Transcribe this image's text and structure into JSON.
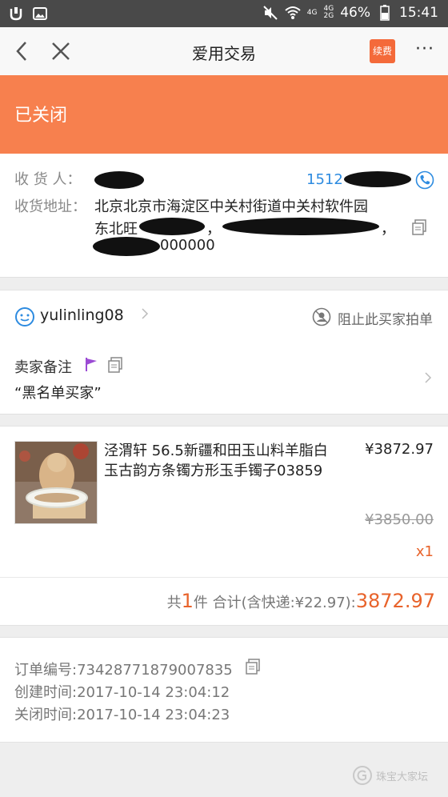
{
  "status_bar": {
    "battery": "46%",
    "time": "15:41",
    "net_top": "4G",
    "net_mid": "4G",
    "net_bottom": "2G"
  },
  "nav": {
    "title": "爱用交易",
    "renew_label": "续费",
    "more_label": "···"
  },
  "banner": {
    "status": "已关闭"
  },
  "address": {
    "recipient_label": "收 货 人：",
    "phone": "1512",
    "address_label": "收货地址：",
    "line1": "北京北京市海淀区中关村街道中关村软件园",
    "line2_prefix": "东北旺",
    "line2_comma1": "，",
    "line2_comma2": "，",
    "line3_suffix": "000000"
  },
  "buyer": {
    "name": "yulinling08",
    "block_label": "阻止此买家拍单"
  },
  "remark": {
    "label": "卖家备注",
    "text": "“黑名单买家”"
  },
  "product": {
    "title": "泾渭轩 56.5新疆和田玉山料羊脂白玉古韵方条镯方形玉手镯子03859",
    "price": "¥3872.97",
    "original_price": "¥3850.00",
    "quantity": "x1"
  },
  "totals": {
    "prefix": "共",
    "count": "1",
    "suffix": "件 合计(含快递:¥22.97):",
    "amount": "3872.97"
  },
  "order": {
    "number_line": "订单编号:73428771879007835",
    "created_line": "创建时间:2017-10-14 23:04:12",
    "closed_line": "关闭时间:2017-10-14 23:04:23"
  },
  "watermark": "珠宝大家坛",
  "colors": {
    "banner": "#f7804e",
    "accent_orange": "#e8632b",
    "phone_blue": "#2d8be0",
    "status_bar": "#494949"
  }
}
